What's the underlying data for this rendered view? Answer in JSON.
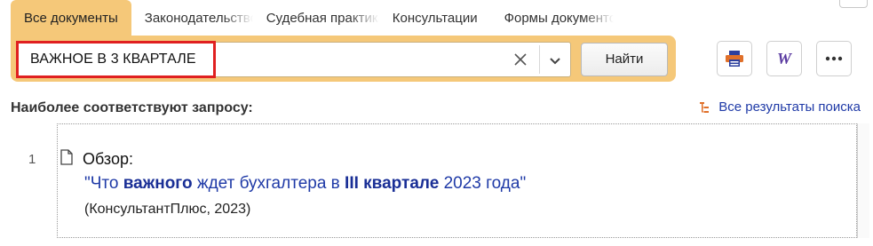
{
  "tabs": [
    {
      "label": "Все документы",
      "active": true
    },
    {
      "label": "Законодательство",
      "active": false
    },
    {
      "label": "Судебная практика",
      "active": false
    },
    {
      "label": "Консультации",
      "active": false
    },
    {
      "label": "Формы документов",
      "active": false
    }
  ],
  "search": {
    "value": "ВАЖНОЕ В 3 КВАРТАЛЕ",
    "button_label": "Найти"
  },
  "toolbar": {
    "print_icon": "print-icon",
    "word_icon": "word-export-icon",
    "more_icon": "more-icon"
  },
  "results_header": {
    "heading": "Наиболее соответствуют запросу:",
    "all_results_link": "Все результаты поиска"
  },
  "results": [
    {
      "number": "1",
      "label": "Обзор:",
      "title_parts": [
        {
          "text": "\"Что ",
          "bold": false
        },
        {
          "text": "важного",
          "bold": true
        },
        {
          "text": " ждет бухгалтера в ",
          "bold": false
        },
        {
          "text": "III квартале",
          "bold": true
        },
        {
          "text": " 2023 года\"",
          "bold": false
        }
      ],
      "source": "(КонсультантПлюс, 2023)"
    }
  ],
  "colors": {
    "accent_band": "#f5c879",
    "link": "#1f3aa7",
    "highlight_border": "#e02020"
  }
}
